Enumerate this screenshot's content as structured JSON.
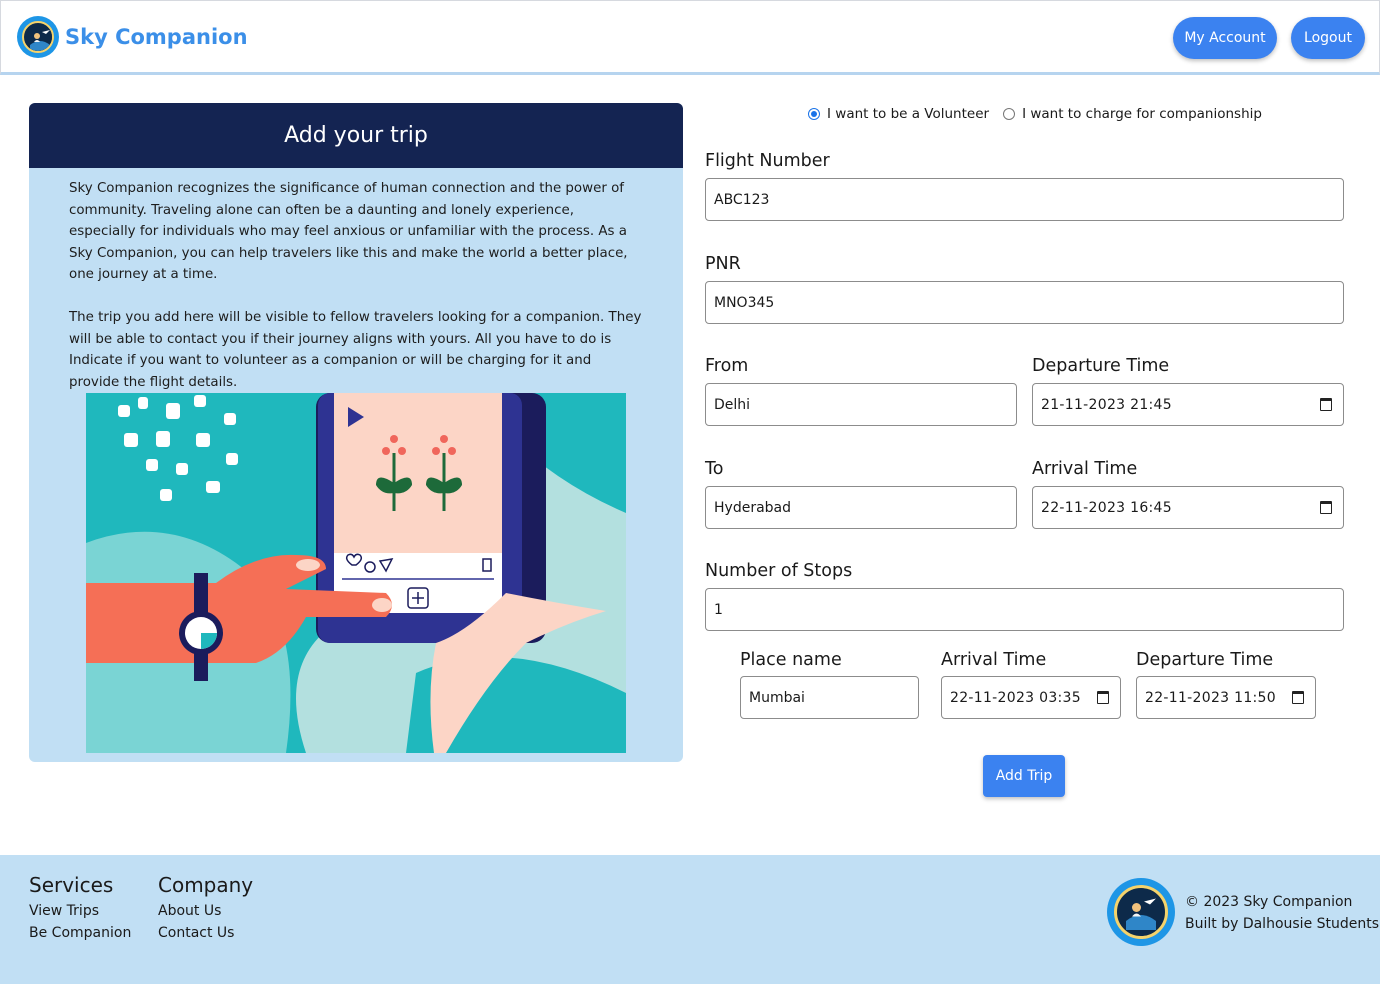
{
  "header": {
    "brand": "Sky Companion",
    "my_account": "My Account",
    "logout": "Logout"
  },
  "card": {
    "title": "Add your trip",
    "paragraph1": "Sky Companion recognizes the significance of human connection and the power of community. Traveling alone can often be a daunting and lonely experience, especially for individuals who may feel anxious or unfamiliar with the process. As a Sky Companion, you can help travelers like this and make the world a better place, one journey at a time.",
    "paragraph2": "The trip you add here will be visible to fellow travelers looking for a companion. They will be able to contact you if their journey aligns with yours. All you have to do is Indicate if you want to volunteer as a companion or will be charging for it and provide the flight details."
  },
  "form": {
    "radio_volunteer": "I want to be a Volunteer",
    "radio_charge": "I want to charge for companionship",
    "selected_option": "volunteer",
    "flight_number_label": "Flight Number",
    "flight_number": "ABC123",
    "pnr_label": "PNR",
    "pnr": "MNO345",
    "from_label": "From",
    "from": "Delhi",
    "departure_label": "Departure Time",
    "departure": "21-11-2023 21:45",
    "to_label": "To",
    "to": "Hyderabad",
    "arrival_label": "Arrival Time",
    "arrival": "22-11-2023 16:45",
    "stops_label": "Number of Stops",
    "stops": "1",
    "stop": {
      "place_label": "Place name",
      "place": "Mumbai",
      "arrival_label": "Arrival Time",
      "arrival": "22-11-2023 03:35",
      "departure_label": "Departure Time",
      "departure": "22-11-2023 11:50"
    },
    "submit": "Add Trip"
  },
  "footer": {
    "services_title": "Services",
    "services": [
      "View Trips",
      "Be Companion"
    ],
    "company_title": "Company",
    "company": [
      "About Us",
      "Contact Us"
    ],
    "copyright": "© 2023 Sky Companion",
    "built_by": "Built by Dalhousie Students"
  },
  "colors": {
    "primary": "#3b82f0",
    "card_header": "#142452",
    "card_bg": "#c1dff4",
    "brand_text": "#3b8fe8"
  }
}
